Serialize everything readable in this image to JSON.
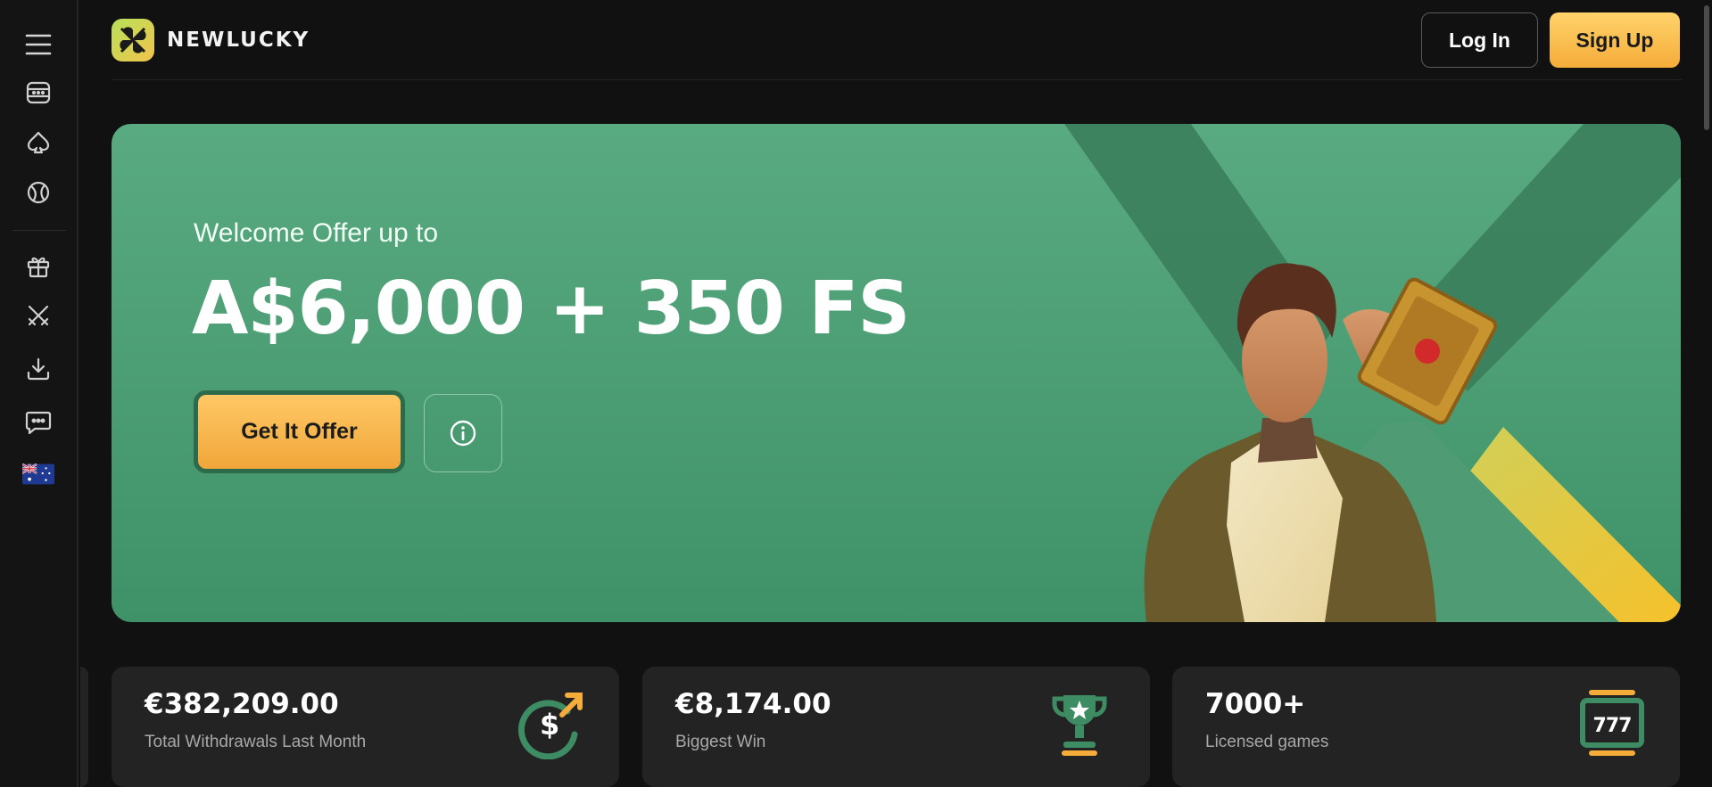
{
  "brand": {
    "name": "NEWLUCKY"
  },
  "header": {
    "login_label": "Log In",
    "signup_label": "Sign Up"
  },
  "sidebar": {
    "items": [
      {
        "icon": "menu-icon"
      },
      {
        "icon": "slot-machine-icon"
      },
      {
        "icon": "spade-icon"
      },
      {
        "icon": "sports-ball-icon"
      },
      {
        "icon": "gift-icon"
      },
      {
        "icon": "tournament-swords-icon"
      },
      {
        "icon": "download-icon"
      },
      {
        "icon": "chat-icon"
      },
      {
        "icon": "australia-flag-icon"
      }
    ]
  },
  "banner": {
    "welcome": "Welcome Offer up to",
    "amount": "A$6,000 + 350 FS",
    "cta_label": "Get It Offer",
    "info_icon": "info-icon"
  },
  "stats": [
    {
      "value": "€382,209.00",
      "label": "Total Withdrawals Last Month",
      "icon": "dollar-arrow-icon"
    },
    {
      "value": "€8,174.00",
      "label": "Biggest Win",
      "icon": "trophy-icon"
    },
    {
      "value": "7000+",
      "label": "Licensed games",
      "icon": "slot-777-icon"
    }
  ],
  "colors": {
    "background": "#111111",
    "banner_green": "#4e9f76",
    "accent_yellow": "#f5ac39",
    "card": "#232323"
  }
}
